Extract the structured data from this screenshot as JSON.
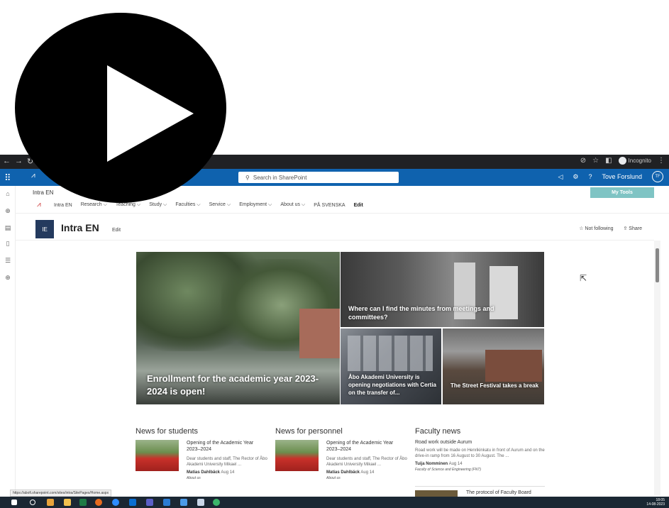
{
  "browser": {
    "incognito_label": "Incognito"
  },
  "suite": {
    "search_placeholder": "Search in SharePoint",
    "user_name": "Tove Forslund",
    "user_initials": "TF"
  },
  "site": {
    "hub_name": "Intra EN",
    "my_tools_label": "My Tools",
    "nav": [
      {
        "label": "Intra EN"
      },
      {
        "label": "Research ⌵"
      },
      {
        "label": "Teaching ⌵"
      },
      {
        "label": "Study ⌵"
      },
      {
        "label": "Faculties ⌵"
      },
      {
        "label": "Service ⌵"
      },
      {
        "label": "Employment ⌵"
      },
      {
        "label": "About us ⌵"
      },
      {
        "label": "PÅ SVENSKA"
      },
      {
        "label": "Edit"
      }
    ],
    "badge": "IE",
    "title": "Intra EN",
    "edit_label": "Edit",
    "not_following_label": "☆ Not following",
    "share_label": "⇪ Share"
  },
  "hero": {
    "main_title": "Enrollment for the academic year 2023-2024 is open!",
    "tile_a_title": "Where can I find the minutes from meetings and committees?",
    "tile_b_title": "Åbo Akademi University is opening negotiations with Certia on the transfer of...",
    "tile_c_title": "The Street Festival takes a break"
  },
  "news_students": {
    "heading": "News for students",
    "title": "Opening of the Academic Year 2023–2024",
    "desc": "Dear students and staff, The Rector of Åbo Akademi University Mikael ...",
    "author": "Matias Dahlbäck",
    "date": "Aug 14",
    "tag": "About us"
  },
  "news_personnel": {
    "heading": "News for personnel",
    "title": "Opening of the Academic Year 2023–2024",
    "desc": "Dear students and staff, The Rector of Åbo Akademi University Mikael ...",
    "author": "Matias Dahlbäck",
    "date": "Aug 14",
    "tag": "About us"
  },
  "faculty_news": {
    "heading": "Faculty news",
    "title": "Road work outside Aurum",
    "desc": "Road work will be made on Henrikinkatu in front of Aurum and on the drive-in ramp from 16 August to 30 August. The ...",
    "author": "Tuija Nomminen",
    "date": "Aug 14",
    "tag": "Faculty of Science and Engineering (FNT)",
    "title2": "The protocol of Faculty Board"
  },
  "status_url": "https://abofi.sharepoint.com/sites/intra/SitePages/Home.aspx",
  "clock": {
    "time": "18:05",
    "date": "14-08-2023"
  },
  "colors": {
    "suite_bar": "#0f62ae",
    "my_tools": "#7fc4c4",
    "site_badge": "#243a5e"
  }
}
